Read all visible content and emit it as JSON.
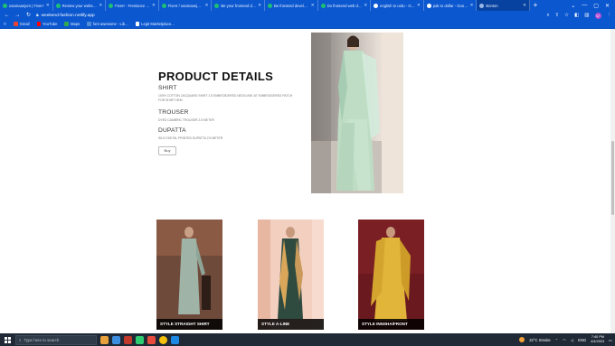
{
  "browser": {
    "tabs": [
      {
        "title": "usamaanjum | Fiverr",
        "favicon": "fiverr-icon",
        "active": false
      },
      {
        "title": "Review your website c...",
        "favicon": "fiverr-icon",
        "active": false
      },
      {
        "title": "Fiverr - Freelance Serv...",
        "favicon": "fiverr-icon",
        "active": false
      },
      {
        "title": "Fiverr / usamaanjum...",
        "favicon": "fiverr-icon",
        "active": false
      },
      {
        "title": "Be your frontend dev...",
        "favicon": "fiverr-icon",
        "active": false
      },
      {
        "title": "Be frontend develope...",
        "favicon": "fiverr-icon",
        "active": false
      },
      {
        "title": "Do frontend web dev...",
        "favicon": "fiverr-icon",
        "active": false
      },
      {
        "title": "english to urdu - Goo...",
        "favicon": "google-icon",
        "active": false
      },
      {
        "title": "pak to dollar - Google...",
        "favicon": "google-icon",
        "active": false
      },
      {
        "title": "Bonton",
        "favicon": "page-icon",
        "active": true
      }
    ],
    "url": "weekend-fashion.netlify.app",
    "bookmarks": [
      {
        "label": "Gmail",
        "color": "#ea4335"
      },
      {
        "label": "YouTube",
        "color": "#ff0000"
      },
      {
        "label": "Maps",
        "color": "#34a853"
      },
      {
        "label": "font awesome - Lib...",
        "color": "#528dd7"
      },
      {
        "label": "Legit Marketplace...",
        "color": "#ffffff"
      }
    ]
  },
  "product": {
    "title": "PRODUCT DETAILS",
    "sections": [
      {
        "heading": "SHIRT",
        "text": "100% COTTON JACQUARD SHIRT 1.5 EMBROIDERED NECKLINE 40\" EMBROIDERED PATCH FOR SHIRT HEM"
      },
      {
        "heading": "TROUSER",
        "text": "DYED CAMBRIC TROUSER 2.5 METER"
      },
      {
        "heading": "DUPATTA",
        "text": "SILK DIGITAL PRINTED DUPATTA 2.5 METER"
      }
    ],
    "buy_label": "Buy"
  },
  "cards": [
    {
      "label": "STYLE STRAIGHT SHIRT"
    },
    {
      "label": "STYLE A-LINE"
    },
    {
      "label": "STYLE INNSHA/FRONT"
    }
  ],
  "taskbar": {
    "search_placeholder": "Type here to search",
    "weather": "22°C Smoke",
    "time": "7:40 PM",
    "date": "4/4/2023",
    "language": "ENG"
  },
  "colors": {
    "browser_chrome": "#0b57d0",
    "taskbar": "#1f2a36",
    "fiverr_green": "#1dbf73"
  }
}
